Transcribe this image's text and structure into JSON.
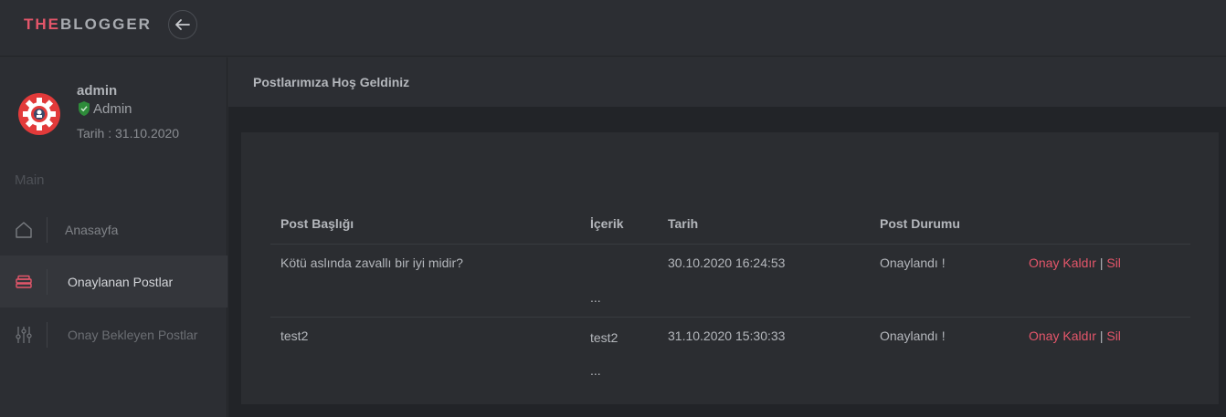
{
  "brand": {
    "part1": "THE",
    "part2": "BLOGGER"
  },
  "topbar": {
    "back_icon": "arrow-left-icon"
  },
  "user": {
    "name": "admin",
    "role": "Admin",
    "date": "Tarih : 31.10.2020"
  },
  "sidebar": {
    "section": "Main",
    "items": [
      {
        "label": "Anasayfa",
        "icon": "home-icon"
      },
      {
        "label": "Onaylanan Postlar",
        "icon": "layers-icon"
      },
      {
        "label": "Onay Bekleyen Postlar",
        "icon": "sliders-icon"
      }
    ]
  },
  "main": {
    "title": "Postlarımıza Hoş Geldiniz",
    "table": {
      "headers": [
        "Post Başlığı",
        "İçerik",
        "Tarih",
        "Post Durumu"
      ],
      "rows": [
        {
          "title": "Kötü aslında zavallı bir iyi midir?",
          "content": "",
          "ellipsis": "...",
          "date": "30.10.2020 16:24:53",
          "status": "Onaylandı !",
          "action1": "Onay Kaldır",
          "sep": "|",
          "action2": "Sil"
        },
        {
          "title": "test2",
          "content": "test2",
          "ellipsis": "...",
          "date": "31.10.2020 15:30:33",
          "status": "Onaylandı !",
          "action1": "Onay Kaldır",
          "sep": "|",
          "action2": "Sil"
        }
      ]
    }
  },
  "colors": {
    "accent": "#e4566a",
    "shield": "#2e8b3a"
  }
}
